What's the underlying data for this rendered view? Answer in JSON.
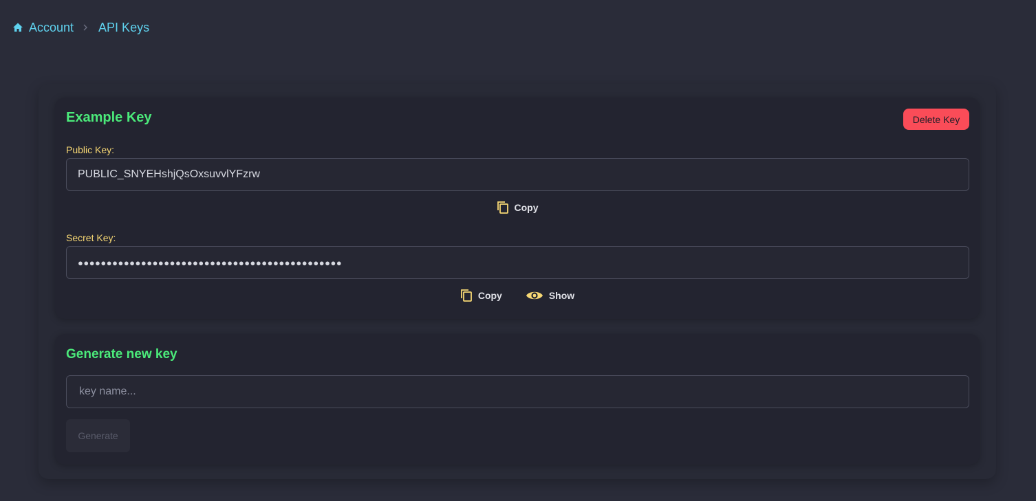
{
  "breadcrumb": {
    "home_icon": "home-icon",
    "items": [
      "Account",
      "API Keys"
    ],
    "separator_icon": "chevron-right-icon"
  },
  "colors": {
    "accent_green": "#4bea7a",
    "label_yellow": "#f7d874",
    "link_cyan": "#5fd2ee",
    "danger_red": "#fa4c58"
  },
  "key_card": {
    "title": "Example Key",
    "delete_label": "Delete Key",
    "public_label": "Public Key:",
    "public_value": "PUBLIC_SNYEHshjQsOxsuvvlYFzrw",
    "public_copy_label": "Copy",
    "secret_label": "Secret Key:",
    "secret_value": "●●●●●●●●●●●●●●●●●●●●●●●●●●●●●●●●●●●●●●●●●●●●●●",
    "secret_copy_label": "Copy",
    "show_label": "Show",
    "copy_icon": "copy-icon",
    "show_icon": "eye-icon"
  },
  "generate_card": {
    "title": "Generate new key",
    "name_placeholder": "key name...",
    "name_value": "",
    "generate_label": "Generate"
  }
}
